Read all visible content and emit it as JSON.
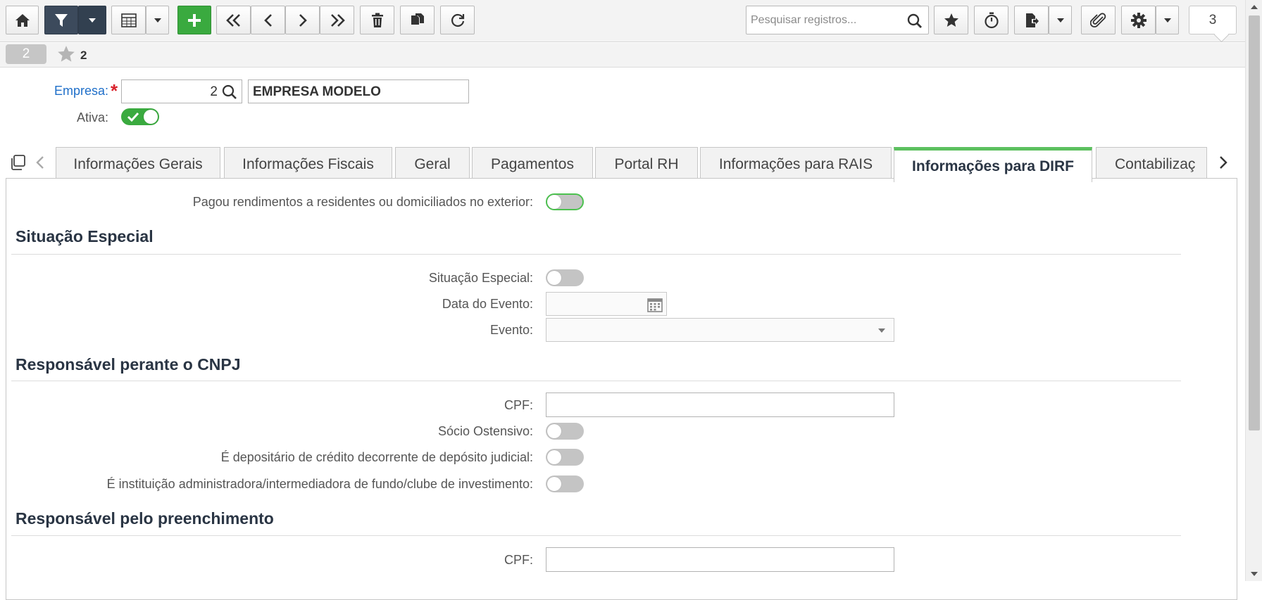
{
  "toolbar": {
    "search_placeholder": "Pesquisar registros...",
    "record_count": "3",
    "icons": [
      "home-icon",
      "filter-icon",
      "chevron-down-icon",
      "grid-icon",
      "plus-icon",
      "first-icon",
      "prev-icon",
      "next-icon",
      "last-icon",
      "trash-icon",
      "copy-icon",
      "refresh-icon",
      "search-icon",
      "star-icon",
      "timer-icon",
      "export-icon",
      "paperclip-icon",
      "gear-icon"
    ],
    "colors": {
      "filter_button": "#3c4a5c",
      "add_button": "#3aaa3f"
    }
  },
  "status": {
    "record_id": "2",
    "favorites_count": "2"
  },
  "header": {
    "empresa_label": "Empresa:",
    "required_mark": "*",
    "empresa_code": "2",
    "empresa_name": "EMPRESA MODELO",
    "ativa_label": "Ativa:",
    "ativa_on": true
  },
  "tabs": [
    {
      "label": "Informações Gerais",
      "active": false
    },
    {
      "label": "Informações Fiscais",
      "active": false
    },
    {
      "label": "Geral",
      "active": false
    },
    {
      "label": "Pagamentos",
      "active": false
    },
    {
      "label": "Portal RH",
      "active": false
    },
    {
      "label": "Informações para RAIS",
      "active": false
    },
    {
      "label": "Informações para DIRF",
      "active": true
    },
    {
      "label": "Contabilizaç",
      "active": false
    }
  ],
  "dirf": {
    "pagou_exterior_label": "Pagou rendimentos a residentes ou domiciliados no exterior:",
    "pagou_exterior_on": false,
    "situacao_section": {
      "title": "Situação Especial",
      "situacao_label": "Situação Especial:",
      "situacao_on": false,
      "data_evento_label": "Data do Evento:",
      "data_evento_value": "",
      "evento_label": "Evento:",
      "evento_value": ""
    },
    "responsavel_cnpj_section": {
      "title": "Responsável perante o CNPJ",
      "cpf_label": "CPF:",
      "cpf_value": "",
      "socio_label": "Sócio Ostensivo:",
      "socio_on": false,
      "depositario_label": "É depositário de crédito decorrente de depósito judicial:",
      "depositario_on": false,
      "instituicao_label": "É instituição administradora/intermediadora de fundo/clube de investimento:",
      "instituicao_on": false
    },
    "preenchimento_section": {
      "title": "Responsável pelo preenchimento",
      "cpf_label": "CPF:",
      "cpf_value": ""
    }
  },
  "colors": {
    "active_tab_accent": "#5cc05f",
    "label_blue": "#1f6fc9",
    "required_red": "#d9232d",
    "toggle_on": "#3aaa3f"
  }
}
